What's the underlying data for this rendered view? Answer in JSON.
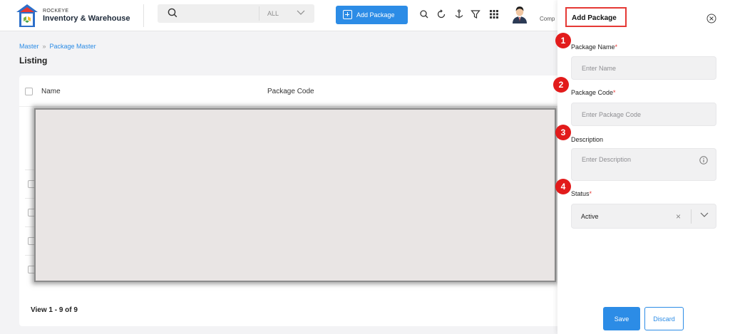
{
  "app": {
    "brand_top": "ROCKEYE",
    "brand_name": "Inventory & Warehouse",
    "company_label": "Comp"
  },
  "search": {
    "scope": "ALL"
  },
  "header": {
    "add_package_label": "Add Package"
  },
  "breadcrumb": {
    "items": [
      "Master",
      "Package Master"
    ]
  },
  "page": {
    "title": "Listing"
  },
  "table": {
    "columns": [
      "Name",
      "Package Code"
    ],
    "footer": "View 1 - 9 of 9"
  },
  "drawer": {
    "title": "Add Package",
    "fields": {
      "package_name": {
        "label": "Package Name",
        "required": "*",
        "placeholder": "Enter Name"
      },
      "package_code": {
        "label": "Package Code",
        "required": "*",
        "placeholder": "Enter Package Code"
      },
      "description": {
        "label": "Description",
        "placeholder": "Enter Description"
      },
      "status": {
        "label": "Status",
        "required": "*",
        "value": "Active"
      }
    },
    "badges": [
      "1",
      "2",
      "3",
      "4"
    ],
    "save_label": "Save",
    "discard_label": "Discard"
  },
  "colors": {
    "accent": "#2c8ce6",
    "badge": "#e21b1b",
    "highlight_border": "#e53935"
  },
  "icons": [
    "search-icon",
    "chevron-down-icon",
    "plus-icon",
    "refresh-icon",
    "anchor-icon",
    "filter-icon",
    "grid-icon",
    "close-icon",
    "info-icon",
    "sliders-icon"
  ]
}
